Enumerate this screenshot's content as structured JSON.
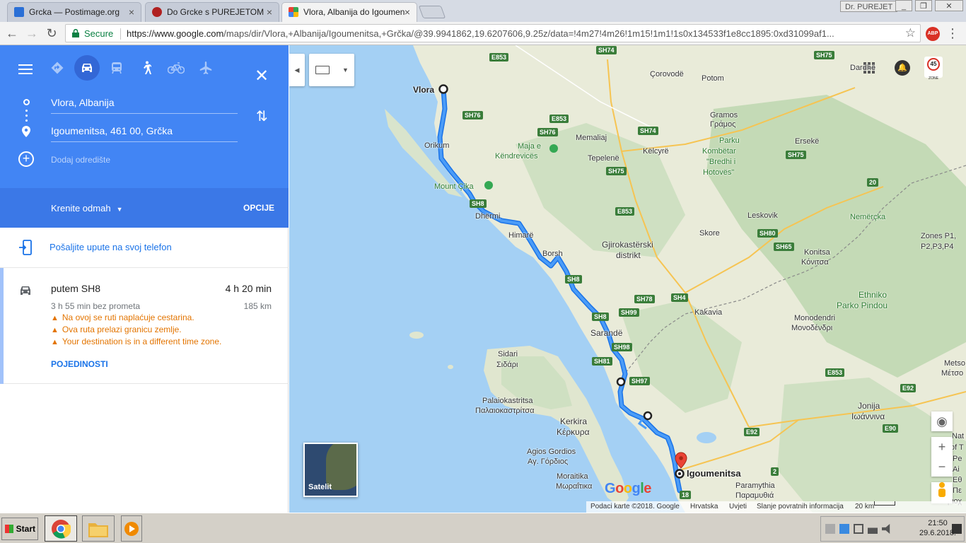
{
  "browser": {
    "tabs": [
      {
        "title": "Grcka — Postimage.org",
        "favicon_color": "#2a6fd6"
      },
      {
        "title": "Do Grcke s PUREJETOM",
        "favicon_color": "#b02020"
      },
      {
        "title": "Vlora, Albanija do Igoumen",
        "favicon_color": "#34a853"
      }
    ],
    "profile": "Dr. PUREJET",
    "secure_label": "Secure",
    "url_host": "https://www.google.com",
    "url_path": "/maps/dir/Vlora,+Albanija/Igoumenitsa,+Grčka/@39.9941862,19.6207606,9.25z/data=!4m27!4m26!1m15!1m1!1s0x134533f1e8cc1895:0xd31099af1...",
    "extension_badge": "ABP"
  },
  "sidebar": {
    "origin": "Vlora, Albanija",
    "destination": "Igoumenitsa, 461 00, Grčka",
    "add_destination": "Dodaj odredište",
    "depart_label": "Krenite odmah",
    "options_label": "OPCIJE",
    "send_to_phone": "Pošaljite upute na svoj telefon",
    "route": {
      "via": "putem SH8",
      "duration": "4 h 20 min",
      "no_traffic": "3 h 55 min bez prometa",
      "distance": "185 km",
      "warnings": [
        "Na ovoj se ruti naplaćuje cestarina.",
        "Ova ruta prelazi granicu zemlje.",
        "Your destination is in a different time zone."
      ],
      "details": "POJEDINOSTI"
    },
    "accent": "#4285f4"
  },
  "map": {
    "satellite_label": "Satelit",
    "zone_sign": "45",
    "zone_text": "ZONE",
    "google_logo": "Google",
    "footer": {
      "data": "Podaci karte ©2018. Google",
      "country": "Hrvatska",
      "terms": "Uvjeti",
      "feedback": "Slanje povratnih informacija",
      "scale": "20 km"
    },
    "cities": {
      "vlora": "Vlora",
      "igoumenitsa": "Igoumenitsa"
    },
    "labels": {
      "corovode": "Çorovodë",
      "potom": "Potom",
      "dardhe": "Dardhë",
      "orikum": "Orikum",
      "memaliaj": "Memaliaj",
      "gramos": "Gramos",
      "gramos_gr": "Γράμος",
      "maja": "Maja e",
      "kendrevices": "Këndrevicës",
      "kelcyre": "Këlcyrë",
      "tepelene": "Tepelenë",
      "park1": "Parku",
      "park2": "Kombëtar",
      "park3": "\"Bredhi i",
      "park4": "Hotovës\"",
      "erseke": "Ersekë",
      "mount_cika": "Mount Çika",
      "dhermi": "Dhërmi",
      "leskovik": "Leskovik",
      "nemercka": "Nemërçka",
      "himare": "Himarë",
      "skore": "Skore",
      "zones1": "Zones P1,",
      "zones2": "P2,P3,P4",
      "borsh": "Borsh",
      "gjiro1": "Gjirokastërski",
      "gjiro2": "distrikt",
      "konitsa": "Konitsa",
      "konitsa_gr": "Κόνιτσα",
      "ethniko1": "Ethniko",
      "ethniko2": "Parko Pindou",
      "kakavia": "Kakavia",
      "sarande": "Sarandë",
      "monod": "Monodendri",
      "monod_gr": "Μονοδένδρι",
      "sidari": "Sidari",
      "sidari_gr": "Σιδάρι",
      "metso": "Metso",
      "metso_gr": "Μέτσο",
      "palaio": "Palaiokastritsa",
      "palaio_gr": "Παλαιοκαστρίτσα",
      "jonija": "Jonija",
      "ioannina": "Ιωάννινα",
      "kerkira": "Kerkira",
      "kerkira_gr": "Κέρκυρα",
      "agios": "Agios Gordios",
      "agios_gr": "Αγ. Γόρδιος",
      "moraitika": "Moraitika",
      "moraitika_gr": "Μωραΐτικα",
      "paramythia": "Paramythia",
      "paramythia_gr": "Παραμυθιά",
      "nat1": "Nat",
      "nat2": "of T",
      "nat3": "Pe",
      "nat4": "Ai",
      "nat5": "Εθ",
      "nat6": "Πε",
      "nat7": "Περιοχ"
    },
    "roads": [
      "E853",
      "SH74",
      "SH75",
      "SH76",
      "E853",
      "SH76",
      "SH74",
      "SH75",
      "SH75",
      "SH8",
      "E853",
      "SH80",
      "SH65",
      "SH8",
      "SH78",
      "SH4",
      "SH8",
      "SH99",
      "SH98",
      "SH81",
      "SH97",
      "E853",
      "E92",
      "E92",
      "E90",
      "20",
      "2",
      "18"
    ],
    "route_color": "#4285f4"
  },
  "taskbar": {
    "start": "Start",
    "time": "21:50",
    "date": "29.6.2018."
  }
}
